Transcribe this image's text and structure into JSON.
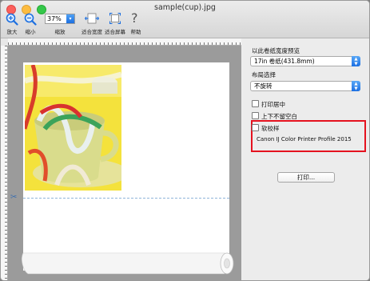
{
  "window": {
    "title": "sample(cup).jpg"
  },
  "toolbar": {
    "zoom_in_label": "放大",
    "zoom_out_label": "缩小",
    "zoom_value": "37%",
    "zoom_label": "缩放",
    "fit_width_label": "适合宽度",
    "fit_screen_label": "适合屏幕",
    "help_label": "帮助",
    "help_glyph": "?"
  },
  "panel": {
    "preview_width_label": "以此卷纸宽度预览",
    "roll_width_value": "17in 卷纸(431.8mm)",
    "layout_label": "布局选择",
    "rotation_value": "不旋转",
    "center_print_label": "打印居中",
    "no_margin_label": "上下不留空白",
    "soft_proof_label": "软校样",
    "profile_name": "Canon IJ Color Printer Profile 2015",
    "print_button_label": "打印..."
  },
  "colors": {
    "accent": "#1c6fe0",
    "highlight": "#e5121f"
  },
  "icons": [
    "zoom-in-icon",
    "zoom-out-icon",
    "fit-width-icon",
    "fit-screen-icon",
    "help-icon",
    "scissors-icon"
  ]
}
